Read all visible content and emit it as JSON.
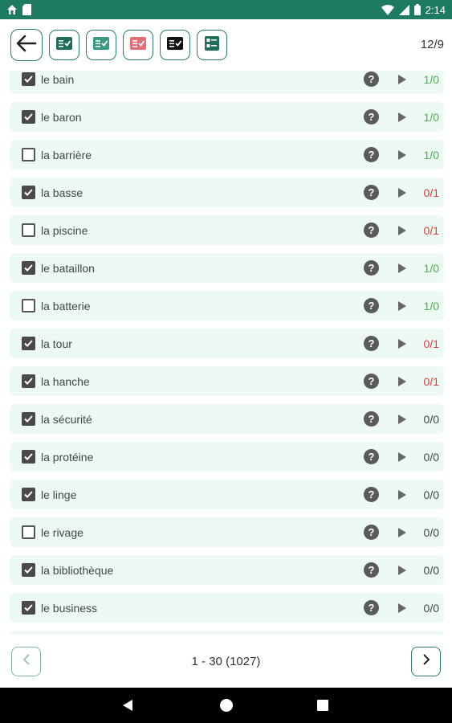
{
  "status_bar": {
    "time": "2:14",
    "bg_color": "#1f7a62"
  },
  "toolbar": {
    "page_indicator": "12/9",
    "buttons": [
      {
        "name": "back-arrow-icon",
        "color": "#2a7d68"
      },
      {
        "name": "list-check-green-icon",
        "color": "#2a7d68"
      },
      {
        "name": "list-check-teal-icon",
        "color": "#3a9a82"
      },
      {
        "name": "list-check-red-icon",
        "color": "#e07078"
      },
      {
        "name": "list-check-black-icon",
        "color": "#111111"
      },
      {
        "name": "list-options-icon",
        "color": "#2a7d68"
      }
    ]
  },
  "words": [
    {
      "label": "le bain",
      "checked": true,
      "score": "1/0",
      "score_color": "green"
    },
    {
      "label": "le baron",
      "checked": true,
      "score": "1/0",
      "score_color": "green"
    },
    {
      "label": "la barrière",
      "checked": false,
      "score": "1/0",
      "score_color": "green"
    },
    {
      "label": "la basse",
      "checked": true,
      "score": "0/1",
      "score_color": "red"
    },
    {
      "label": "la piscine",
      "checked": false,
      "score": "0/1",
      "score_color": "red"
    },
    {
      "label": "le bataillon",
      "checked": true,
      "score": "1/0",
      "score_color": "green"
    },
    {
      "label": "la batterie",
      "checked": false,
      "score": "1/0",
      "score_color": "green"
    },
    {
      "label": "la tour",
      "checked": true,
      "score": "0/1",
      "score_color": "red"
    },
    {
      "label": "la hanche",
      "checked": true,
      "score": "0/1",
      "score_color": "red"
    },
    {
      "label": "la sécurité",
      "checked": true,
      "score": "0/0",
      "score_color": "gray"
    },
    {
      "label": "la protéine",
      "checked": true,
      "score": "0/0",
      "score_color": "gray"
    },
    {
      "label": "le linge",
      "checked": true,
      "score": "0/0",
      "score_color": "gray"
    },
    {
      "label": "le rivage",
      "checked": false,
      "score": "0/0",
      "score_color": "gray"
    },
    {
      "label": "la bibliothèque",
      "checked": true,
      "score": "0/0",
      "score_color": "gray"
    },
    {
      "label": "le business",
      "checked": true,
      "score": "0/0",
      "score_color": "gray"
    }
  ],
  "help_glyph": "?",
  "pagination": {
    "range_text": "1 - 30 (1027)"
  },
  "colors": {
    "row_bg": "#ecfaf3",
    "accent": "#2a7d68",
    "green": "#4caf50",
    "red": "#e53935"
  }
}
